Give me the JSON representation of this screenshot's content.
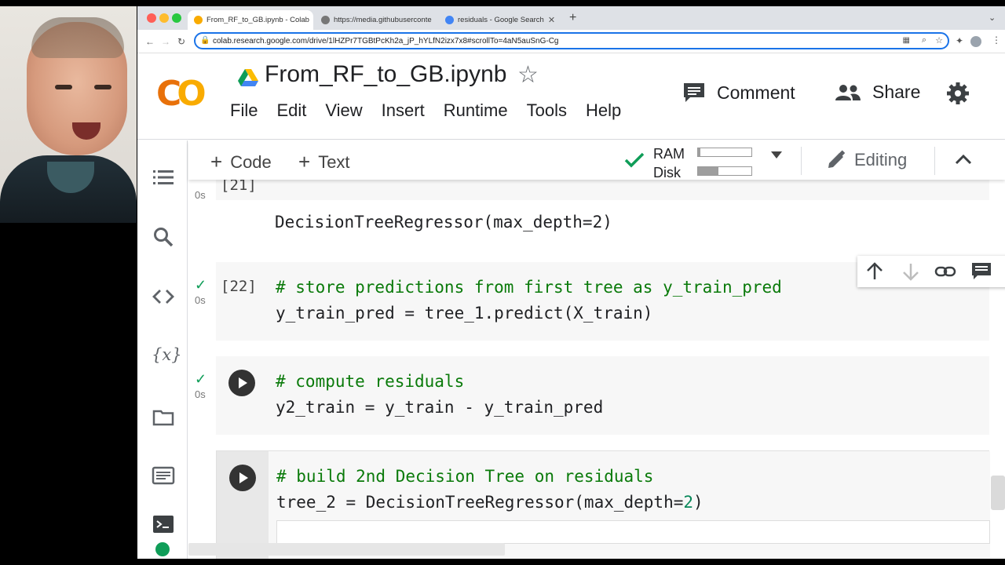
{
  "browser": {
    "tabs": [
      {
        "label": "From_RF_to_GB.ipynb - Colab",
        "active": true
      },
      {
        "label": "https://media.githubuserconte",
        "active": false
      },
      {
        "label": "residuals - Google Search",
        "active": false
      }
    ],
    "url": "colab.research.google.com/drive/1lHZPr7TGBtPcKh2a_jP_hYLfN2izx7x8#scrollTo=4aN5auSnG-Cg"
  },
  "header": {
    "logo": "CO",
    "notebook_title": "From_RF_to_GB.ipynb",
    "menu": [
      "File",
      "Edit",
      "View",
      "Insert",
      "Runtime",
      "Tools",
      "Help"
    ],
    "comment_label": "Comment",
    "share_label": "Share"
  },
  "toolbar": {
    "add_code_label": "Code",
    "add_text_label": "Text",
    "ram_label": "RAM",
    "disk_label": "Disk",
    "ram_usage": 0.05,
    "disk_usage": 0.38,
    "editing_label": "Editing"
  },
  "cells": {
    "output_cell": {
      "exec_count": "[21]",
      "runtime": "0s",
      "output": "DecisionTreeRegressor(max_depth=2)"
    },
    "cell_22": {
      "exec_count": "[22]",
      "runtime": "0s",
      "comment": "# store predictions from first tree as y_train_pred",
      "line2": "y_train_pred = tree_1.predict(X_train)"
    },
    "cell_residuals": {
      "runtime": "0s",
      "comment": "# compute residuals",
      "line2": "y2_train = y_train - y_train_pred"
    },
    "cell_tree2": {
      "comment": "# build 2nd Decision Tree on residuals",
      "line2_a": "tree_2 = DecisionTreeRegressor(max_depth=",
      "line2_num": "2",
      "line2_b": ")"
    }
  },
  "colors": {
    "accent": "#1a73e8",
    "comment": "#0a7a0a",
    "success": "#0f9d58",
    "status_dot": "#0f9d58"
  }
}
